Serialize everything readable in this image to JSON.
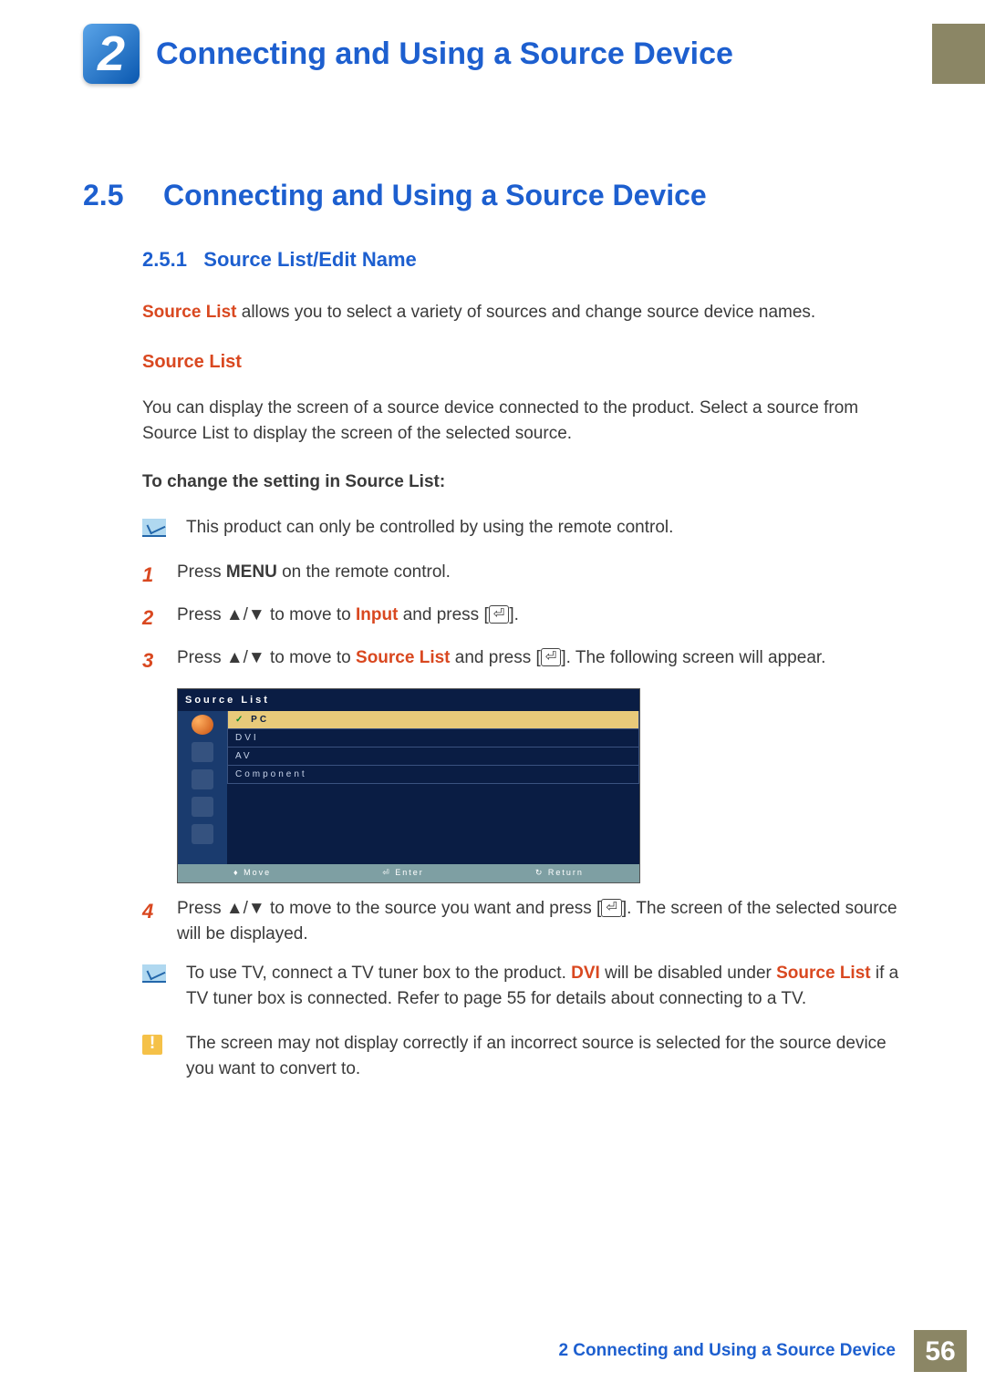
{
  "chapter": {
    "number": "2",
    "title": "Connecting and Using a Source Device"
  },
  "section": {
    "number": "2.5",
    "title": "Connecting and Using a Source Device"
  },
  "subsection": {
    "number": "2.5.1",
    "title": "Source List/Edit Name"
  },
  "intro": {
    "kw": "Source List",
    "after": " allows you to select a variety of sources and change source device names."
  },
  "subhead1": "Source List",
  "para1": "You can display the screen of a source device connected to the product. Select a source from Source List to display the screen of the selected source.",
  "bold_head": "To change the setting in Source List:",
  "note1": "This product can only be controlled by using the remote control.",
  "steps": {
    "s1": {
      "num": "1",
      "pre": "Press ",
      "kw": "MENU",
      "post": " on the remote control."
    },
    "s2": {
      "num": "2",
      "pre": "Press ▲/▼ to move to ",
      "kw": "Input",
      "post": " and press [",
      "bracket": "]."
    },
    "s3": {
      "num": "3",
      "pre": "Press ▲/▼ to move to ",
      "kw": "Source List",
      "post": " and press [",
      "bracket": "]. The following screen will appear."
    },
    "s4": {
      "num": "4",
      "pre": "Press ▲/▼ to move to the source you want and press [",
      "bracket": "]. The screen of the selected source will be displayed."
    }
  },
  "osd": {
    "title": "Source List",
    "items": [
      "PC",
      "DVI",
      "AV",
      "Component"
    ],
    "foot_move": "♦ Move",
    "foot_enter": "⏎ Enter",
    "foot_return": "↻ Return"
  },
  "note2": {
    "pre": "To use TV, connect a TV tuner box to the product. ",
    "kw1": "DVI",
    "mid": " will be disabled under ",
    "kw2": "Source List",
    "post": " if a TV tuner box is connected. Refer to page 55 for details about connecting to a TV."
  },
  "warn": "The screen may not display correctly if an incorrect source is selected for the source device you want to convert to.",
  "footer": {
    "text": "2 Connecting and Using a Source Device",
    "page": "56"
  },
  "icons": {
    "enter": "⏎",
    "warn": "!"
  }
}
